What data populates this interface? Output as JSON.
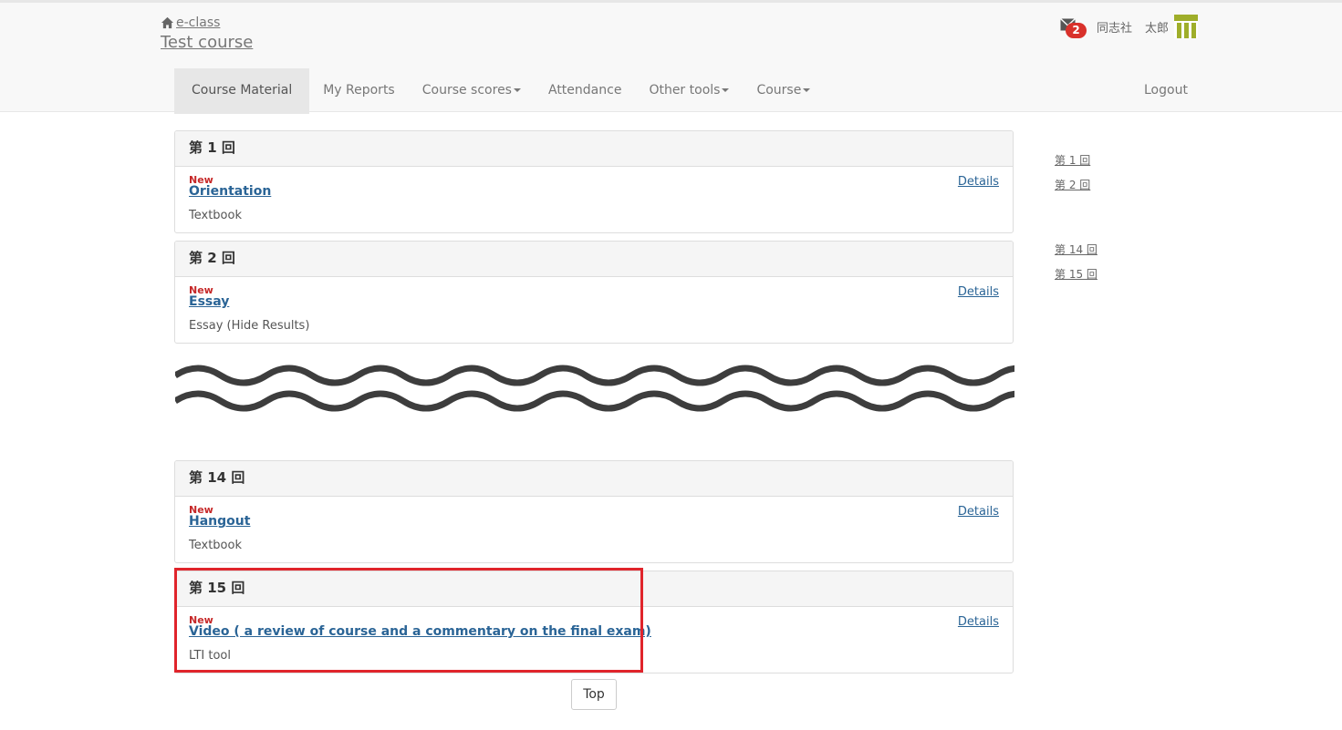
{
  "header": {
    "site_name": "e-class",
    "course_name": "Test course",
    "mail_count": "2",
    "affiliation": "同志社",
    "user_name": "太郎",
    "logout_label": "Logout"
  },
  "nav": [
    {
      "label": "Course Material",
      "active": true,
      "dropdown": false
    },
    {
      "label": "My Reports",
      "active": false,
      "dropdown": false
    },
    {
      "label": "Course scores",
      "active": false,
      "dropdown": true
    },
    {
      "label": "Attendance",
      "active": false,
      "dropdown": false
    },
    {
      "label": "Other tools",
      "active": false,
      "dropdown": true
    },
    {
      "label": "Course",
      "active": false,
      "dropdown": true
    }
  ],
  "sessions": [
    {
      "heading": "第 1 回",
      "new_label": "New",
      "title": "Orientation",
      "type": "Textbook",
      "details_label": "Details"
    },
    {
      "heading": "第 2 回",
      "new_label": "New",
      "title": "Essay",
      "type": "Essay (Hide Results)",
      "details_label": "Details"
    },
    {
      "heading": "第 14 回",
      "new_label": "New",
      "title": "Hangout",
      "type": "Textbook",
      "details_label": "Details"
    },
    {
      "heading": "第 15 回",
      "new_label": "New",
      "title": "Video ( a review of course and a commentary on the final exam)",
      "type": "LTI tool",
      "details_label": "Details"
    }
  ],
  "side_links": [
    "第 1 回",
    "第 2 回",
    "第 14 回",
    "第 15 回"
  ],
  "top_button_label": "Top",
  "colors": {
    "link": "#2a6496",
    "new_label": "#c62828",
    "badge": "#d9312b",
    "highlight": "#e0242b",
    "logo": "#9fae2a"
  }
}
